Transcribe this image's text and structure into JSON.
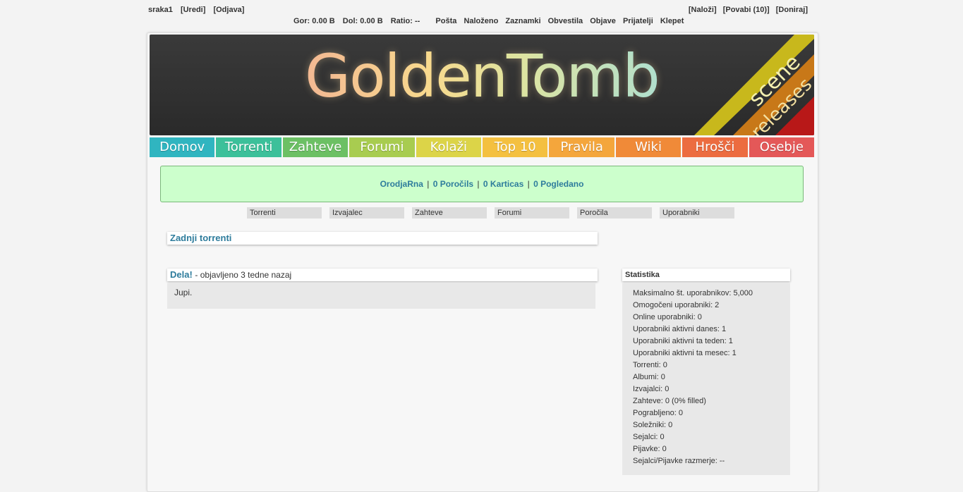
{
  "user": {
    "name": "sraka1",
    "edit": "[Uredi]",
    "logout": "[Odjava]",
    "upload": "[Naloži]",
    "invite": "[Povabi (10)]",
    "donate": "[Doniraj]"
  },
  "stats": {
    "up_label": "Gor:",
    "up_value": "0.00 B",
    "down_label": "Dol:",
    "down_value": "0.00 B",
    "ratio_label": "Ratio:",
    "ratio_value": "--"
  },
  "toplinks": [
    "Pošta",
    "Naloženo",
    "Zaznamki",
    "Obvestila",
    "Objave",
    "Prijatelji",
    "Klepet"
  ],
  "banner": {
    "logo": "GoldenTomb",
    "stripe1": "scene",
    "stripe2": "releases"
  },
  "nav": [
    {
      "label": "Domov",
      "color": "#30b5c0"
    },
    {
      "label": "Torrenti",
      "color": "#3cc09a"
    },
    {
      "label": "Zahteve",
      "color": "#6cc064"
    },
    {
      "label": "Forumi",
      "color": "#a8cc50"
    },
    {
      "label": "Kolaži",
      "color": "#dcd448"
    },
    {
      "label": "Top 10",
      "color": "#f4c040"
    },
    {
      "label": "Pravila",
      "color": "#f4a63c"
    },
    {
      "label": "Wiki",
      "color": "#f08a38"
    },
    {
      "label": "Hrošči",
      "color": "#ec6c40"
    },
    {
      "label": "Osebje",
      "color": "#e45858"
    }
  ],
  "alert": {
    "items": [
      "OrodjaRna",
      "0 Poročils",
      "0 Karticas",
      "0 Pogledano"
    ],
    "separator": "|"
  },
  "search_tabs": [
    "Torrenti",
    "Izvajalec",
    "Zahteve",
    "Forumi",
    "Poročila",
    "Uporabniki"
  ],
  "latest_torrents": {
    "title": "Zadnji torrenti"
  },
  "news": {
    "title": "Dela!",
    "meta": "- objavljeno 3 tedne nazaj",
    "body": "Jupi."
  },
  "statistics": {
    "title": "Statistika",
    "rows": [
      "Maksimalno št. uporabnikov: 5,000",
      "Omogočeni uporabniki: 2",
      "Online uporabniki: 0",
      "Uporabniki aktivni danes: 1",
      "Uporabniki aktivni ta teden: 1",
      "Uporabniki aktivni ta mesec: 1",
      "Torrenti: 0",
      "Albumi: 0",
      "Izvajalci: 0",
      "Zahteve: 0 (0% filled)",
      "Pograbljeno: 0",
      "Soležniki: 0",
      "Sejalci: 0",
      "Pijavke: 0",
      "Sejalci/Pijavke razmerje: --"
    ]
  }
}
